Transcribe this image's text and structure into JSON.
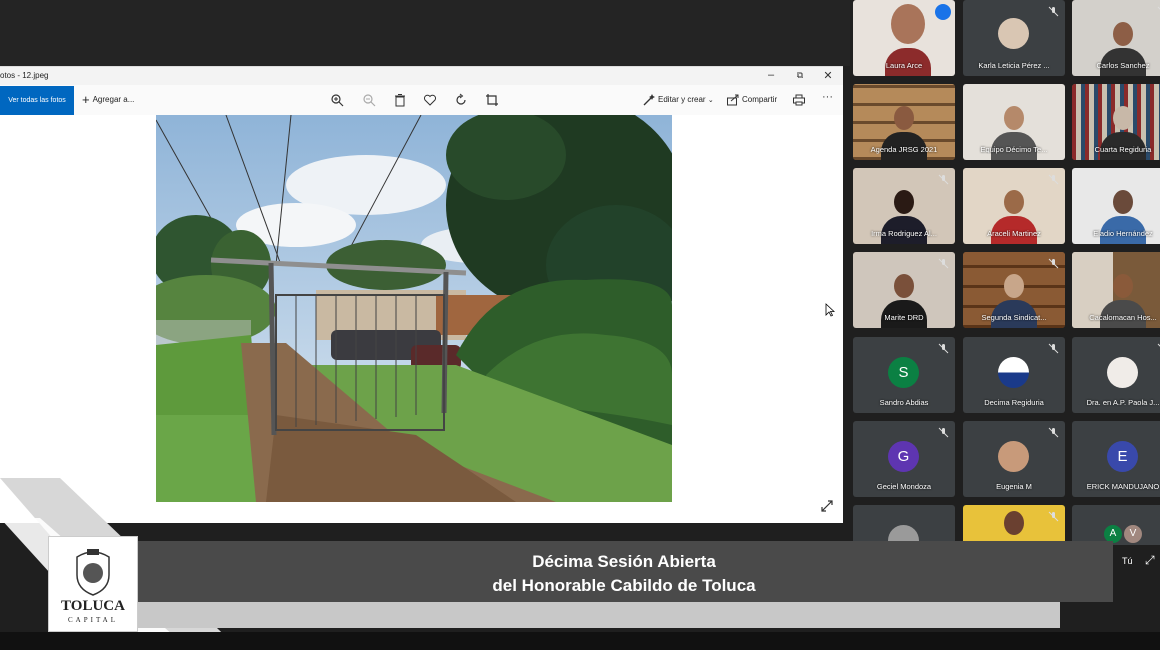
{
  "viewer": {
    "title": "otos - 12.jpeg",
    "view_all_label": "Ver todas las fotos",
    "add_label": "Agregar a...",
    "edit_label": "Editar y crear",
    "share_label": "Compartir"
  },
  "participants": [
    {
      "name": "Laura Arce",
      "speaking": true
    },
    {
      "name": "Karla Leticia Pérez ...",
      "muted": true
    },
    {
      "name": "Carlos Sanchez",
      "muted": true
    },
    {
      "name": "Agenda JRSG 2021"
    },
    {
      "name": "Equipo Décimo Te..."
    },
    {
      "name": "Cuarta Regiduria"
    },
    {
      "name": "Irma Rodriguez Al...",
      "muted": true
    },
    {
      "name": "Araceli Martinez",
      "muted": true
    },
    {
      "name": "Eladio Hernández"
    },
    {
      "name": "Marite DRD",
      "muted": true
    },
    {
      "name": "Segunda Sindicat...",
      "muted": true
    },
    {
      "name": "Cacalomacan Hos..."
    },
    {
      "name": "Sandro Abdias",
      "initial": "S",
      "color": "#0b8043",
      "muted": true
    },
    {
      "name": "Decima Regiduria",
      "muted": true
    },
    {
      "name": "Dra. en A.P. Paola J...",
      "muted": true
    },
    {
      "name": "Geciel Mondoza",
      "initial": "G",
      "color": "#5e35b1",
      "muted": true
    },
    {
      "name": "Eugenia M",
      "muted": true
    },
    {
      "name": "ERICK MANDUJANO",
      "initial": "E",
      "color": "#3949ab"
    }
  ],
  "others": {
    "initials": [
      "A",
      "V"
    ],
    "you_label": "Tú"
  },
  "banner": {
    "line1": "Décima Sesión Abierta",
    "line2": "del Honorable Cabildo de Toluca"
  },
  "logo": {
    "name": "TOLUCA",
    "subtitle": "CAPITAL"
  },
  "colors": {
    "accent": "#0067c0",
    "meet_tile": "#3c4043",
    "banner": "#4a4a4a"
  }
}
